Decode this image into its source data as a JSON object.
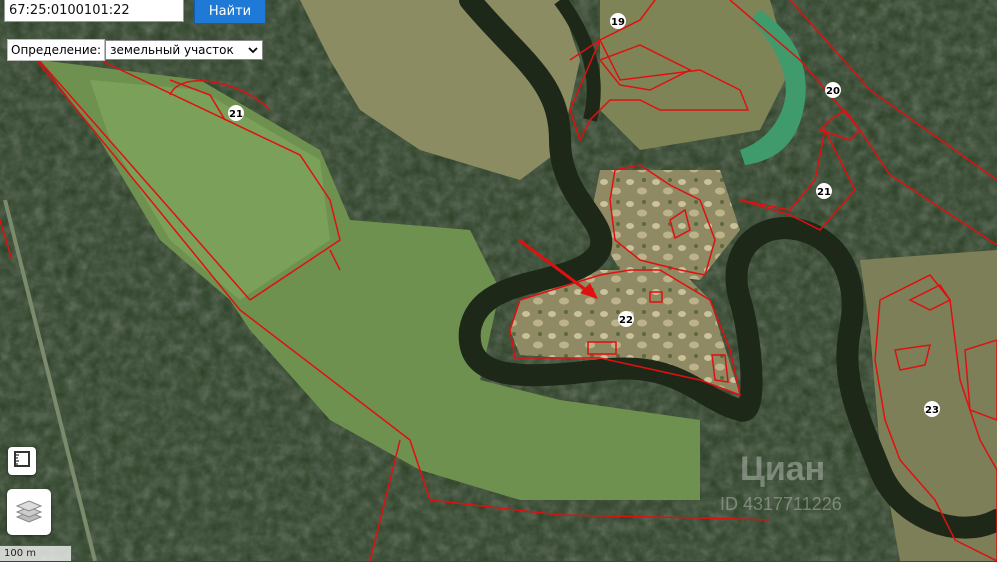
{
  "search": {
    "value": "67:25:0100101:22",
    "button_label": "Найти"
  },
  "definition": {
    "label": "Определение:",
    "selected": "земельный участок"
  },
  "parcels": [
    {
      "label": "19"
    },
    {
      "label": "20"
    },
    {
      "label": "21"
    },
    {
      "label": "21"
    },
    {
      "label": "22"
    },
    {
      "label": "23"
    }
  ],
  "scale": {
    "label": "100 m"
  },
  "watermark": {
    "brand": "Циан",
    "id": "ID 4317711226"
  },
  "colors": {
    "boundary": "#e01010",
    "button": "#1e7ad6",
    "river": "#1f2a1a",
    "forest": "#1f3a1c",
    "field": "#6c8f48"
  },
  "icons": {
    "layers": "layers-icon",
    "ruler": "ruler-icon",
    "marker": "red-arrow-marker"
  }
}
